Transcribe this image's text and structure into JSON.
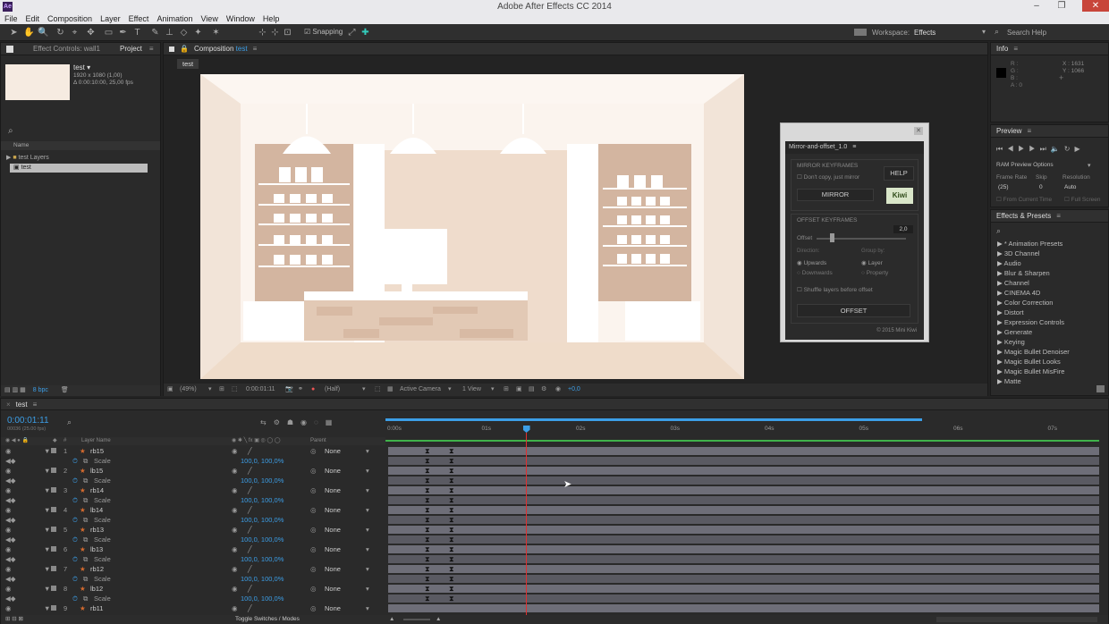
{
  "app": {
    "title": "Adobe After Effects CC 2014",
    "logo": "Ae"
  },
  "menu": [
    "File",
    "Edit",
    "Composition",
    "Layer",
    "Effect",
    "Animation",
    "View",
    "Window",
    "Help"
  ],
  "toolbar": {
    "snapping": "Snapping",
    "workspace_label": "Workspace:",
    "workspace_value": "Effects",
    "search_help": "Search Help"
  },
  "project": {
    "tabs": [
      "Effect Controls: wall1",
      "Project"
    ],
    "item_name": "test ▾",
    "item_info1": "1920 x 1080 (1,00)",
    "item_info2": "Δ 0:00:10:00, 25,00 fps",
    "col_name": "Name",
    "items": [
      {
        "label": "test Layers"
      },
      {
        "label": "test"
      }
    ],
    "bpc": "8 bpc"
  },
  "composition": {
    "tab_label": "Composition",
    "tab_name": "test",
    "subtab": "test",
    "zoom": "(49%)",
    "timecode": "0:00:01:11",
    "resolution": "(Half)",
    "camera": "Active Camera",
    "view": "1 View",
    "exposure": "+0,0"
  },
  "plugin": {
    "title": "Mirror-and-offset_1.0",
    "mirror_section": "MIRROR KEYFRAMES",
    "dont_copy": "Don't copy, just mirror",
    "help": "HELP",
    "mirror_btn": "MIRROR",
    "offset_section": "OFFSET KEYFRAMES",
    "offset_label": "Offset",
    "offset_value": "2,0",
    "direction_label": "Direction:",
    "group_label": "Group by:",
    "upwards": "Upwards",
    "downwards": "Downwards",
    "layer": "Layer",
    "property": "Property",
    "shuffle": "Shuffle layers before offset",
    "offset_btn": "OFFSET",
    "copyright": "© 2015 Mini Kiwi",
    "logo": "Kiwi"
  },
  "info": {
    "title": "Info",
    "r": "R :",
    "g": "G :",
    "b": "B :",
    "a": "A : 0",
    "x": "X : 1631",
    "y": "Y : 1066"
  },
  "preview": {
    "title": "Preview",
    "ram_options": "RAM Preview Options",
    "frame_rate_label": "Frame Rate",
    "skip_label": "Skip",
    "resolution_label": "Resolution",
    "frame_rate": "(25)",
    "skip": "0",
    "resolution": "Auto",
    "from_current": "From Current Time",
    "full_screen": "Full Screen"
  },
  "effects": {
    "title": "Effects & Presets",
    "items": [
      "* Animation Presets",
      "3D Channel",
      "Audio",
      "Blur & Sharpen",
      "Channel",
      "CINEMA 4D",
      "Color Correction",
      "Distort",
      "Expression Controls",
      "Generate",
      "Keying",
      "Magic Bullet Denoiser",
      "Magic Bullet Looks",
      "Magic Bullet MisFire",
      "Matte"
    ]
  },
  "timeline": {
    "tab": "test",
    "timecode": "0:00:01:11",
    "fps": "00036 (25.00 fps)",
    "col_hash": "#",
    "col_layer": "Layer Name",
    "col_parent": "Parent",
    "ruler": [
      "0:00s",
      "01s",
      "02s",
      "03s",
      "04s",
      "05s",
      "06s",
      "07s"
    ],
    "toggle": "Toggle Switches / Modes",
    "current_time_fraction": 0.197,
    "layers": [
      {
        "num": "1",
        "name": "rb15",
        "parent": "None",
        "prop": "Scale",
        "value": "100,0, 100,0%"
      },
      {
        "num": "2",
        "name": "lb15",
        "parent": "None",
        "prop": "Scale",
        "value": "100,0, 100,0%"
      },
      {
        "num": "3",
        "name": "rb14",
        "parent": "None",
        "prop": "Scale",
        "value": "100,0, 100,0%"
      },
      {
        "num": "4",
        "name": "lb14",
        "parent": "None",
        "prop": "Scale",
        "value": "100,0, 100,0%"
      },
      {
        "num": "5",
        "name": "rb13",
        "parent": "None",
        "prop": "Scale",
        "value": "100,0, 100,0%"
      },
      {
        "num": "6",
        "name": "lb13",
        "parent": "None",
        "prop": "Scale",
        "value": "100,0, 100,0%"
      },
      {
        "num": "7",
        "name": "rb12",
        "parent": "None",
        "prop": "Scale",
        "value": "100,0, 100,0%"
      },
      {
        "num": "8",
        "name": "lb12",
        "parent": "None",
        "prop": "Scale",
        "value": "100,0, 100,0%"
      },
      {
        "num": "9",
        "name": "rb11",
        "parent": "None"
      }
    ]
  },
  "colors": {
    "accent": "#3c9ee6",
    "playhead": "#e03030",
    "wall": "#f6ebe1",
    "wood": "#d2b29c"
  }
}
